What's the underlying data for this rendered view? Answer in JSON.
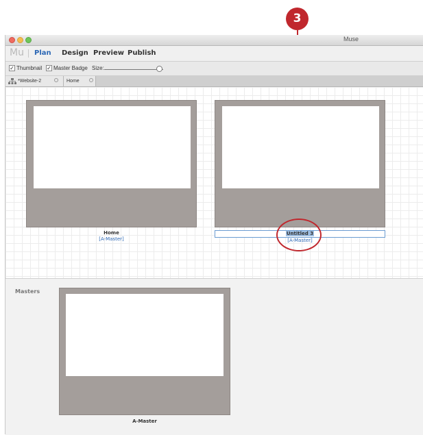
{
  "callout": {
    "number": "3"
  },
  "window": {
    "title": "Muse"
  },
  "menubar": {
    "logo": "Mu",
    "modes": [
      {
        "label": "Plan",
        "active": true
      },
      {
        "label": "Design",
        "active": false
      },
      {
        "label": "Preview",
        "active": false
      },
      {
        "label": "Publish",
        "active": false
      }
    ]
  },
  "options": {
    "thumbnail_label": "Thumbnail",
    "master_badge_label": "Master Badge",
    "size_label": "Size:",
    "check_glyph": "✓"
  },
  "tabs": [
    {
      "label": "*Website-2"
    },
    {
      "label": "Home"
    }
  ],
  "pages": [
    {
      "name": "Home",
      "master": "[A-Master]"
    },
    {
      "name": "Untitled 3",
      "master": "[A-Master]"
    }
  ],
  "masters": {
    "section_label": "Masters",
    "items": [
      {
        "name": "A-Master"
      }
    ]
  },
  "colors": {
    "accent": "#2a66b4",
    "callout": "#c0272d",
    "thumb": "#a49e9b"
  }
}
